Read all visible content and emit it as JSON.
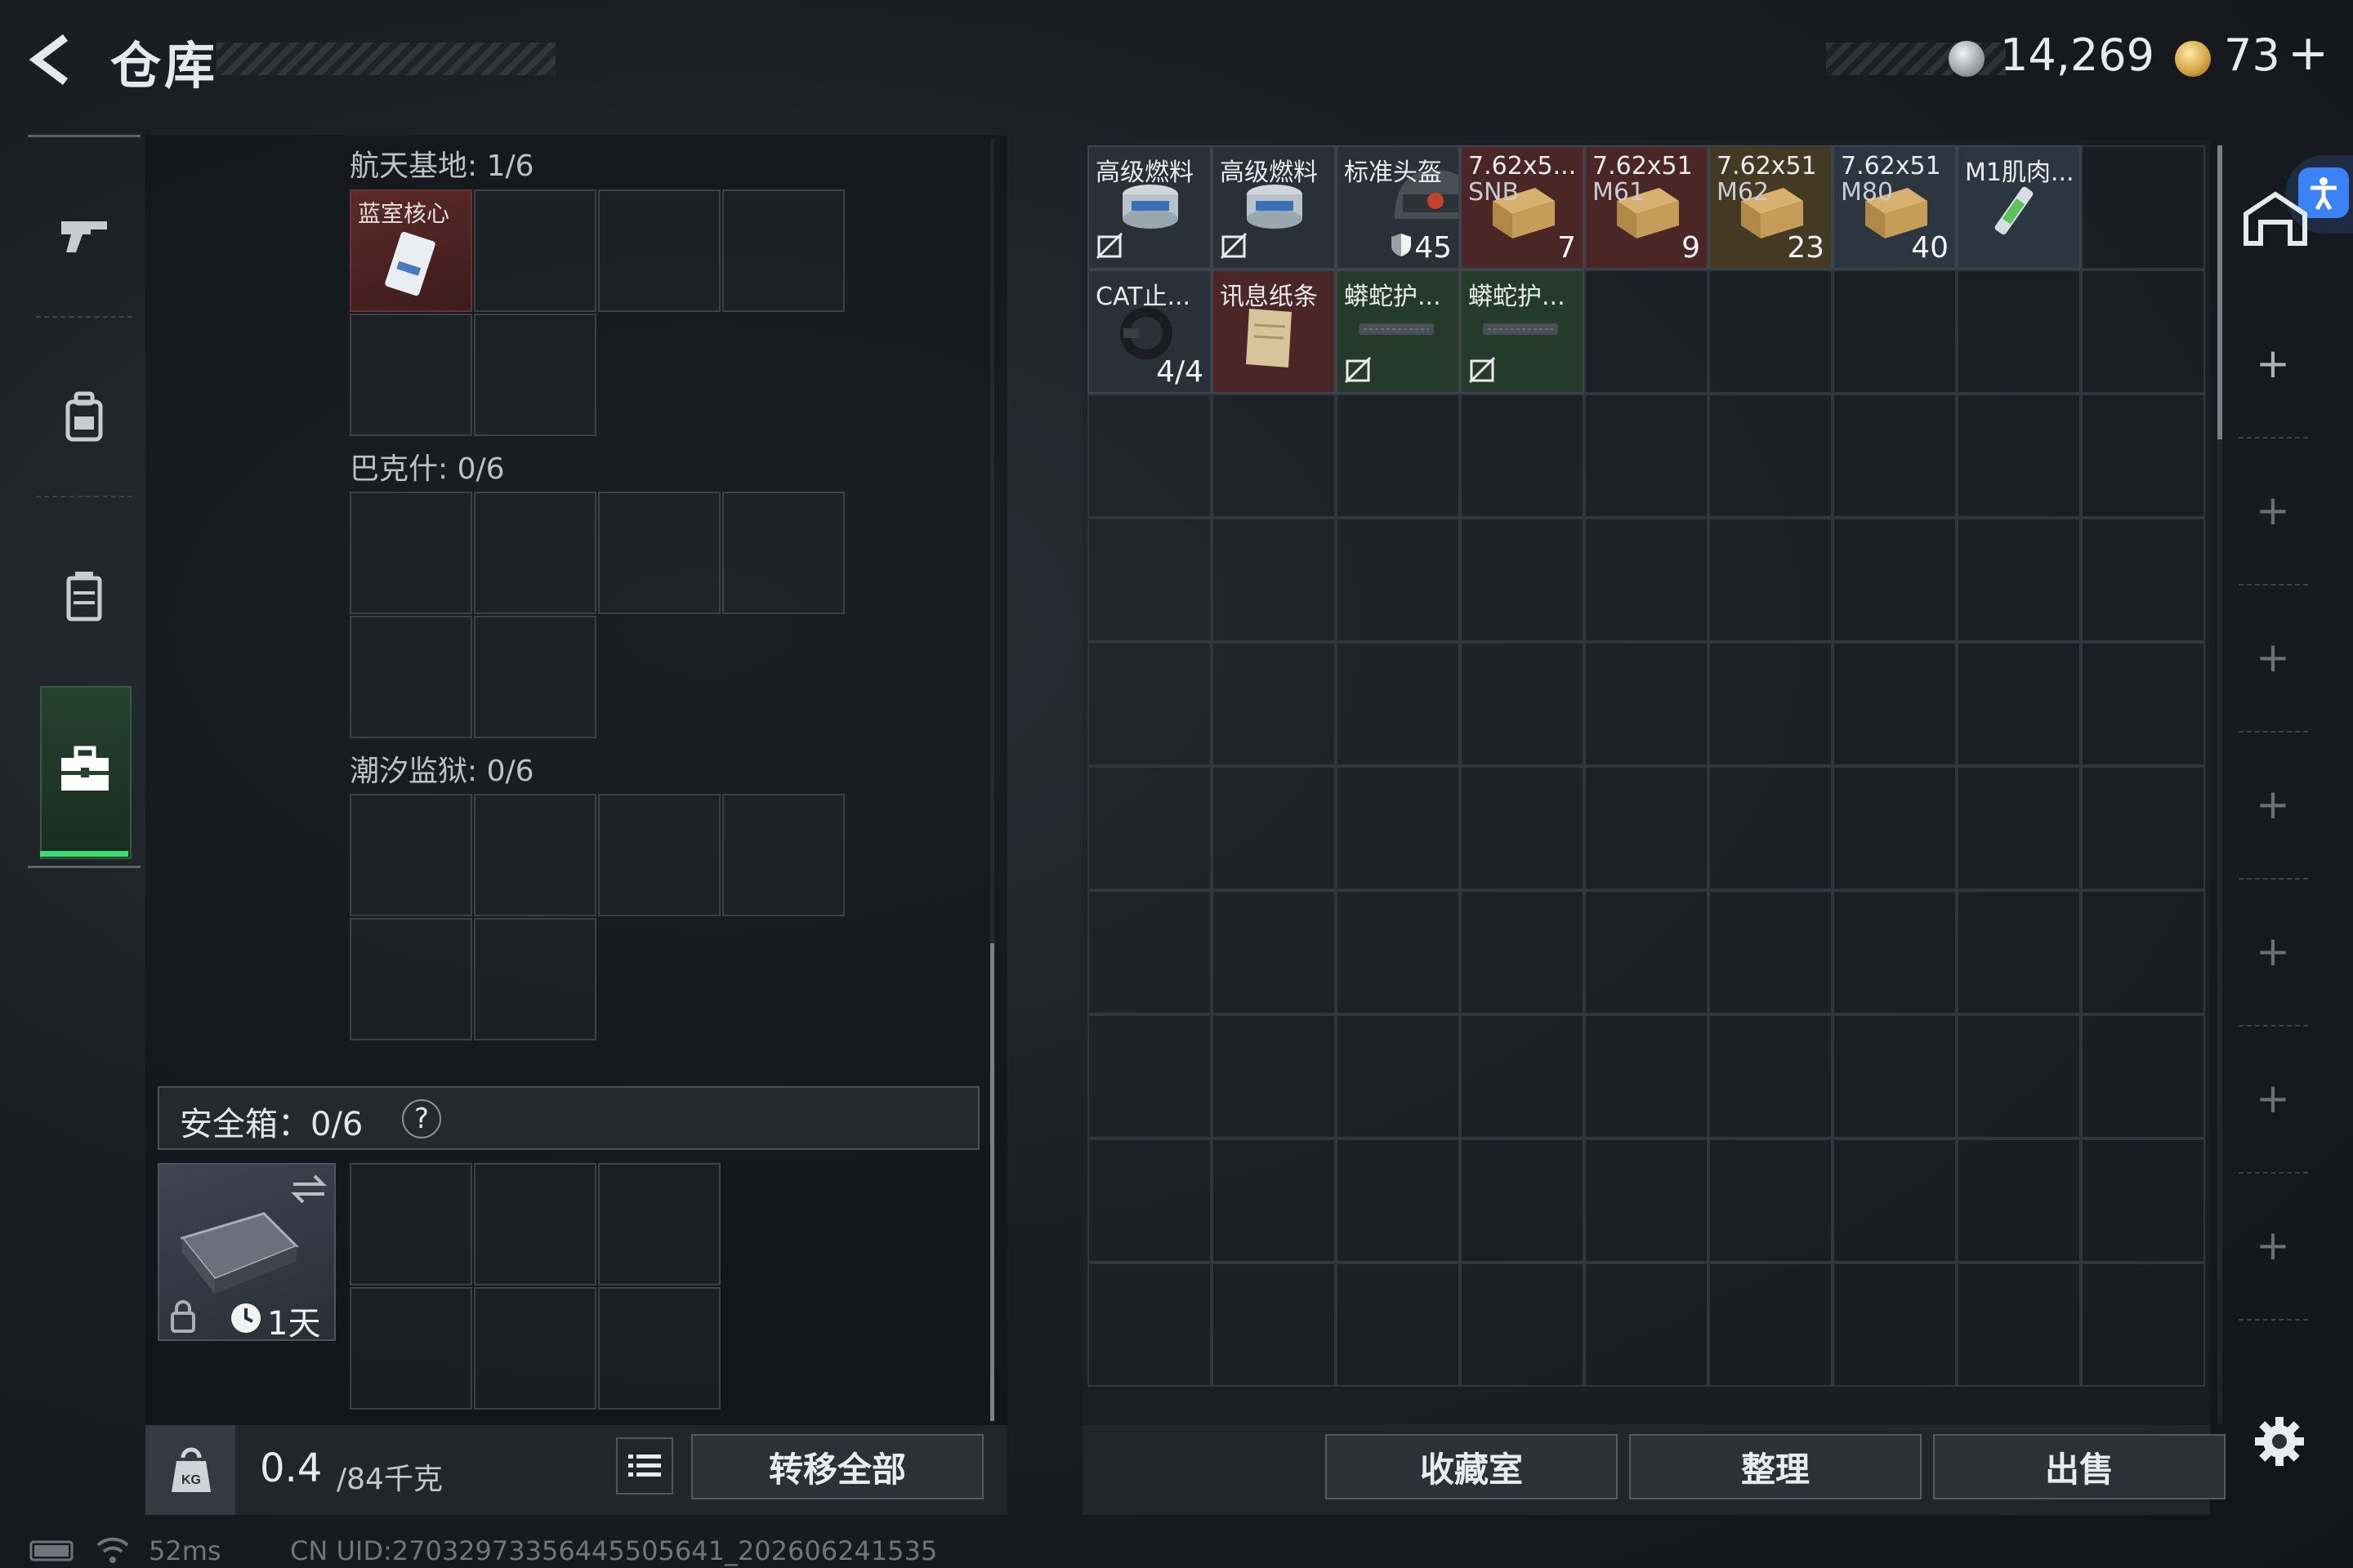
{
  "header": {
    "title": "仓库",
    "currency1": "14,269",
    "currency2": "73",
    "currency2_plus": "+"
  },
  "nav": {
    "items": [
      "gun-icon",
      "backpack-icon",
      "vest-icon",
      "toolbox-icon"
    ],
    "active_index": 3
  },
  "storage": {
    "sections": [
      {
        "label": "航天基地: 1/6",
        "items": [
          {
            "name": "蓝室核心"
          }
        ]
      },
      {
        "label": "巴克什: 0/6",
        "items": []
      },
      {
        "label": "潮汐监狱: 0/6",
        "items": []
      }
    ],
    "safe_box": {
      "label": "安全箱：0/6",
      "help": "?",
      "timer": "1天"
    }
  },
  "footer_left": {
    "weight": "0.4",
    "weight_max": "/84千克",
    "transfer_all": "转移全部"
  },
  "status": {
    "ping": "52ms",
    "uid": "CN UID:2703297335644550564​1_202606241535"
  },
  "inventory": {
    "items": [
      {
        "name": "高级燃料",
        "qty": "",
        "color": "#2a3038"
      },
      {
        "name": "高级燃料",
        "qty": "",
        "color": "#2a3038"
      },
      {
        "name": "标准头盔",
        "qty": "45",
        "color": "#2a3038"
      },
      {
        "name": "7.62x5...",
        "sub": "SNB",
        "qty": "7",
        "color": "#4a2626"
      },
      {
        "name": "7.62x51",
        "sub": "M61",
        "qty": "9",
        "color": "#4a2626"
      },
      {
        "name": "7.62x51",
        "sub": "M62",
        "qty": "23",
        "color": "#443a24"
      },
      {
        "name": "7.62x51",
        "sub": "M80",
        "qty": "40",
        "color": "#2c3640"
      },
      {
        "name": "M1肌肉...",
        "qty": "",
        "color": "#2c3640"
      },
      {
        "name": "CAT止...",
        "qty": "4/4",
        "color": "#2a3038"
      },
      {
        "name": "讯息纸条",
        "qty": "",
        "color": "#4a2626"
      },
      {
        "name": "蟒蛇护...",
        "qty": "",
        "color": "#263a2c"
      },
      {
        "name": "蟒蛇护...",
        "qty": "",
        "color": "#263a2c"
      }
    ]
  },
  "footer_right": {
    "collection": "收藏室",
    "sort": "整理",
    "sell": "出售"
  },
  "colors": {
    "accent_green": "#3ddc74",
    "access_blue": "#3b82f6"
  }
}
